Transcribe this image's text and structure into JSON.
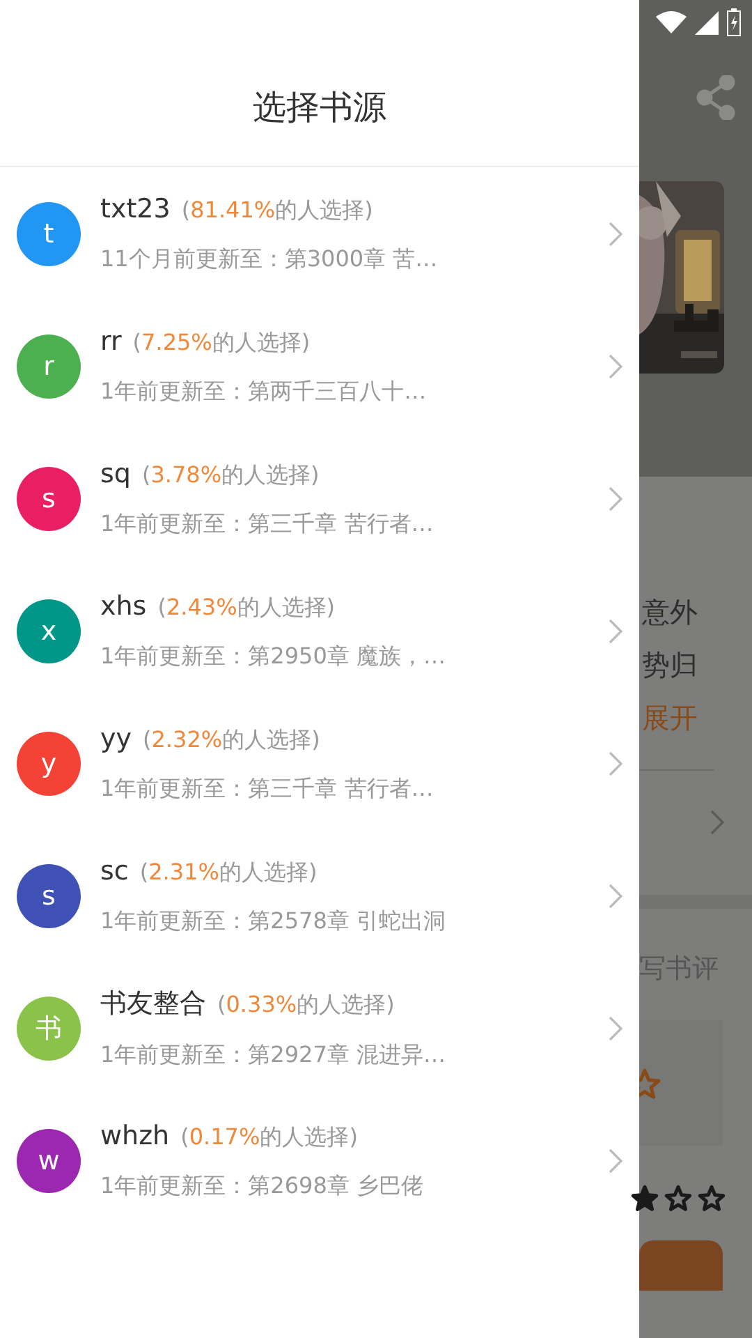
{
  "drawer": {
    "title": "选择书源",
    "sources": [
      {
        "initial": "t",
        "color": "#2196f3",
        "name": "txt23",
        "share_prefix": "(",
        "share": "81.41%",
        "share_suffix": "的人选择)",
        "update": "11个月前更新至：第3000章 苦…"
      },
      {
        "initial": "r",
        "color": "#4caf50",
        "name": "rr",
        "share_prefix": "(",
        "share": "7.25%",
        "share_suffix": "的人选择)",
        "update": "1年前更新至：第两千三百八十…"
      },
      {
        "initial": "s",
        "color": "#e91e63",
        "name": "sq",
        "share_prefix": "(",
        "share": "3.78%",
        "share_suffix": "的人选择)",
        "update": "1年前更新至：第三千章 苦行者…"
      },
      {
        "initial": "x",
        "color": "#009688",
        "name": "xhs",
        "share_prefix": "(",
        "share": "2.43%",
        "share_suffix": "的人选择)",
        "update": "1年前更新至：第2950章 魔族，…"
      },
      {
        "initial": "y",
        "color": "#f44336",
        "name": "yy",
        "share_prefix": "(",
        "share": "2.32%",
        "share_suffix": "的人选择)",
        "update": "1年前更新至：第三千章 苦行者…"
      },
      {
        "initial": "s",
        "color": "#3f51b5",
        "name": "sc",
        "share_prefix": "(",
        "share": "2.31%",
        "share_suffix": "的人选择)",
        "update": "1年前更新至：第2578章 引蛇出洞"
      },
      {
        "initial": "书",
        "color": "#8bc34a",
        "name": "书友整合",
        "share_prefix": "(",
        "share": "0.33%",
        "share_suffix": "的人选择)",
        "update": "1年前更新至：第2927章 混进异…"
      },
      {
        "initial": "w",
        "color": "#9c27b0",
        "name": "whzh",
        "share_prefix": "(",
        "share": "0.17%",
        "share_suffix": "的人选择)",
        "update": "1年前更新至：第2698章 乡巴佬"
      }
    ]
  },
  "background": {
    "synopsis_lines": [
      "意外",
      "势归"
    ],
    "expand": "展开",
    "review_link": "写书评",
    "stars": 1
  }
}
